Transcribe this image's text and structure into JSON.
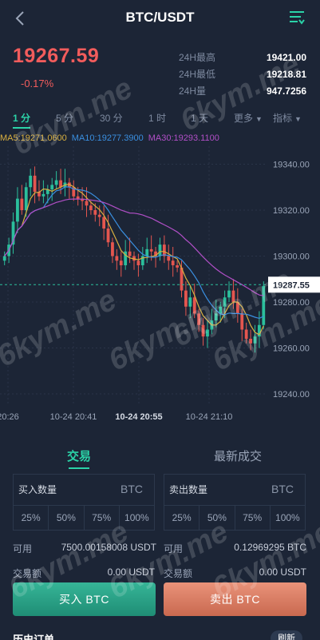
{
  "header": {
    "title": "BTC/USDT"
  },
  "ticker": {
    "price": "19267.59",
    "change": "-0.17%",
    "stats": [
      {
        "label": "24H最高",
        "value": "19421.00"
      },
      {
        "label": "24H最低",
        "value": "19218.81"
      },
      {
        "label": "24H量",
        "value": "947.7256"
      }
    ]
  },
  "periods": [
    {
      "label": "1 分",
      "active": true
    },
    {
      "label": "5 分"
    },
    {
      "label": "30 分"
    },
    {
      "label": "1 时"
    },
    {
      "label": "1 天"
    },
    {
      "label": "更多"
    },
    {
      "label": "指标"
    }
  ],
  "indicators": {
    "ma5": "MA5:19271.0600",
    "ma10": "MA10:19277.3900",
    "ma30": "MA30:19293.1100"
  },
  "chart_data": {
    "type": "candlestick",
    "y_ticks": [
      "19340.00",
      "19320.00",
      "19300.00",
      "19280.00",
      "19260.00",
      "19240.00"
    ],
    "x_ticks": [
      "20:26",
      "10-24 20:41",
      "10-24 20:55",
      "10-24 21:10"
    ],
    "current_price_label": "19287.55",
    "ylim": [
      19235,
      19352
    ],
    "colors": {
      "up": "#2bbf9c",
      "down": "#e4564f",
      "ma5": "#d9b040",
      "ma10": "#3a8fe0",
      "ma30": "#b14fc7"
    }
  },
  "tabs": {
    "trade": "交易",
    "latest": "最新成交"
  },
  "buy": {
    "qty_label": "买入数量",
    "unit": "BTC",
    "percents": [
      "25%",
      "50%",
      "75%",
      "100%"
    ],
    "available_label": "可用",
    "available_value": "7500.00158008 USDT",
    "amount_label": "交易额",
    "amount_value": "0.00 USDT",
    "button": "买入 BTC"
  },
  "sell": {
    "qty_label": "卖出数量",
    "unit": "BTC",
    "percents": [
      "25%",
      "50%",
      "75%",
      "100%"
    ],
    "available_label": "可用",
    "available_value": "0.12969295 BTC",
    "amount_label": "交易额",
    "amount_value": "0.00 USDT",
    "button": "卖出 BTC"
  },
  "history": {
    "title": "历史订单",
    "refresh": "刷新"
  },
  "watermark": "6kym.me"
}
